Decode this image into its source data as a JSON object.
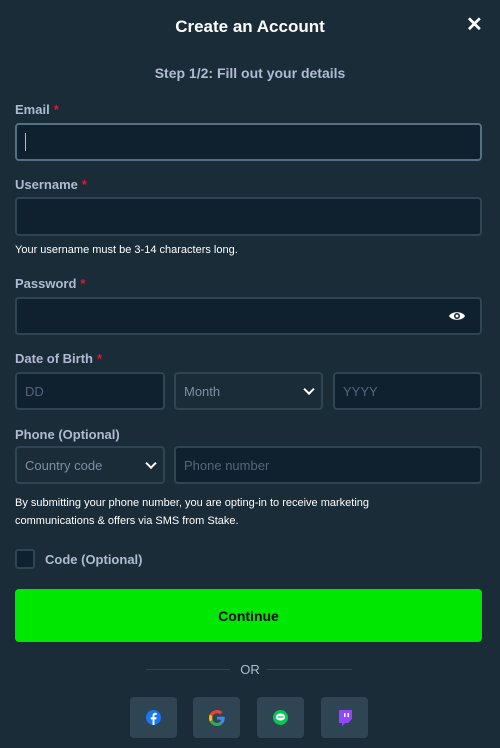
{
  "dialog": {
    "title": "Create an Account",
    "close_icon": "close-icon",
    "step": "Step 1/2: Fill out your details"
  },
  "form": {
    "email": {
      "label": "Email",
      "required": "*",
      "value": ""
    },
    "username": {
      "label": "Username",
      "required": "*",
      "value": "",
      "help": "Your username must be 3-14 characters long."
    },
    "password": {
      "label": "Password",
      "required": "*",
      "value": "",
      "icon": "eye-icon"
    },
    "dob": {
      "label": "Date of Birth",
      "required": "*",
      "day_placeholder": "DD",
      "month_placeholder": "Month",
      "year_placeholder": "YYYY"
    },
    "phone": {
      "label": "Phone (Optional)",
      "country_placeholder": "Country code",
      "number_placeholder": "Phone number",
      "disclaimer_line1": "By submitting your phone number, you are opting-in to receive marketing",
      "disclaimer_line2": "communications & offers via SMS from Stake."
    },
    "code": {
      "label": "Code (Optional)",
      "checked": false
    }
  },
  "continue_label": "Continue",
  "or_label": "OR",
  "social": [
    "facebook-icon",
    "google-icon",
    "line-icon",
    "twitch-icon"
  ],
  "colors": {
    "background": "#1a2c38",
    "input": "#0f212e",
    "border": "#2f4553",
    "accent": "#00e701",
    "required": "#e9113c"
  }
}
